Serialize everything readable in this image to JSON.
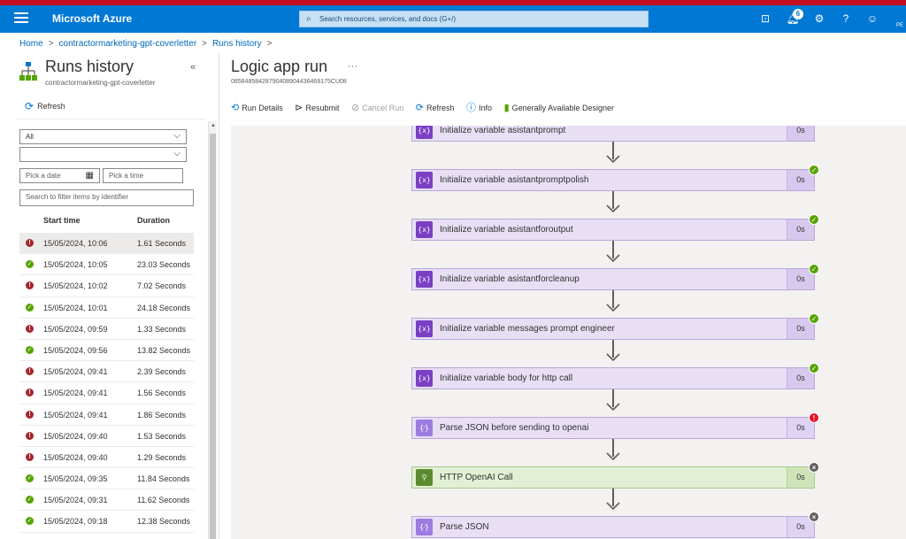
{
  "topbar": {
    "brand": "Microsoft Azure",
    "search_placeholder": "Search resources, services, and docs (G+/)",
    "notification_count": "6",
    "user_initials": "PE"
  },
  "breadcrumb": [
    {
      "label": "Home"
    },
    {
      "label": "contractormarketing-gpt-coverletter"
    },
    {
      "label": "Runs history"
    }
  ],
  "runs_blade": {
    "title": "Runs history",
    "subtitle": "contractormarketing-gpt-coverletter",
    "refresh_label": "Refresh",
    "status_filter": "All",
    "second_filter": "",
    "date_placeholder": "Pick a date",
    "time_placeholder": "Pick a time",
    "search_placeholder": "Search to filter items by identifier",
    "col_start": "Start time",
    "col_duration": "Duration",
    "runs": [
      {
        "status": "failed",
        "start": "15/05/2024, 10:06",
        "duration": "1.61 Seconds"
      },
      {
        "status": "succeeded",
        "start": "15/05/2024, 10:05",
        "duration": "23.03 Seconds"
      },
      {
        "status": "failed",
        "start": "15/05/2024, 10:02",
        "duration": "7.02 Seconds"
      },
      {
        "status": "succeeded",
        "start": "15/05/2024, 10:01",
        "duration": "24.18 Seconds"
      },
      {
        "status": "failed",
        "start": "15/05/2024, 09:59",
        "duration": "1.33 Seconds"
      },
      {
        "status": "succeeded",
        "start": "15/05/2024, 09:56",
        "duration": "13.82 Seconds"
      },
      {
        "status": "failed",
        "start": "15/05/2024, 09:41",
        "duration": "2.39 Seconds"
      },
      {
        "status": "failed",
        "start": "15/05/2024, 09:41",
        "duration": "1.56 Seconds"
      },
      {
        "status": "failed",
        "start": "15/05/2024, 09:41",
        "duration": "1.86 Seconds"
      },
      {
        "status": "failed",
        "start": "15/05/2024, 09:40",
        "duration": "1.53 Seconds"
      },
      {
        "status": "failed",
        "start": "15/05/2024, 09:40",
        "duration": "1.29 Seconds"
      },
      {
        "status": "succeeded",
        "start": "15/05/2024, 09:35",
        "duration": "11.84 Seconds"
      },
      {
        "status": "succeeded",
        "start": "15/05/2024, 09:31",
        "duration": "11.62 Seconds"
      },
      {
        "status": "succeeded",
        "start": "15/05/2024, 09:18",
        "duration": "12.38 Seconds"
      }
    ]
  },
  "run_blade": {
    "title": "Logic app run",
    "run_id": "08584858428790408904436469175CU08",
    "commands": {
      "run_details": "Run Details",
      "resubmit": "Resubmit",
      "cancel_run": "Cancel Run",
      "refresh": "Refresh",
      "info": "Info",
      "designer": "Generally Available Designer"
    },
    "steps": [
      {
        "label": "Initialize variable asistantprompt",
        "duration": "0s",
        "status": "",
        "kind": "variable"
      },
      {
        "label": "Initialize variable asistantpromptpolish",
        "duration": "0s",
        "status": "succeeded",
        "kind": "variable"
      },
      {
        "label": "Initialize variable asistantforoutput",
        "duration": "0s",
        "status": "succeeded",
        "kind": "variable"
      },
      {
        "label": "Initialize variable asistantforcleanup",
        "duration": "0s",
        "status": "succeeded",
        "kind": "variable"
      },
      {
        "label": "Initialize variable messages prompt engineer",
        "duration": "0s",
        "status": "succeeded",
        "kind": "variable"
      },
      {
        "label": "Initialize variable body for http call",
        "duration": "0s",
        "status": "succeeded",
        "kind": "variable"
      },
      {
        "label": "Parse JSON before sending to openai",
        "duration": "0s",
        "status": "failed",
        "kind": "parse"
      },
      {
        "label": "HTTP OpenAI Call",
        "duration": "0s",
        "status": "skipped",
        "kind": "http"
      },
      {
        "label": "Parse JSON",
        "duration": "0s",
        "status": "skipped",
        "kind": "parse"
      }
    ]
  }
}
